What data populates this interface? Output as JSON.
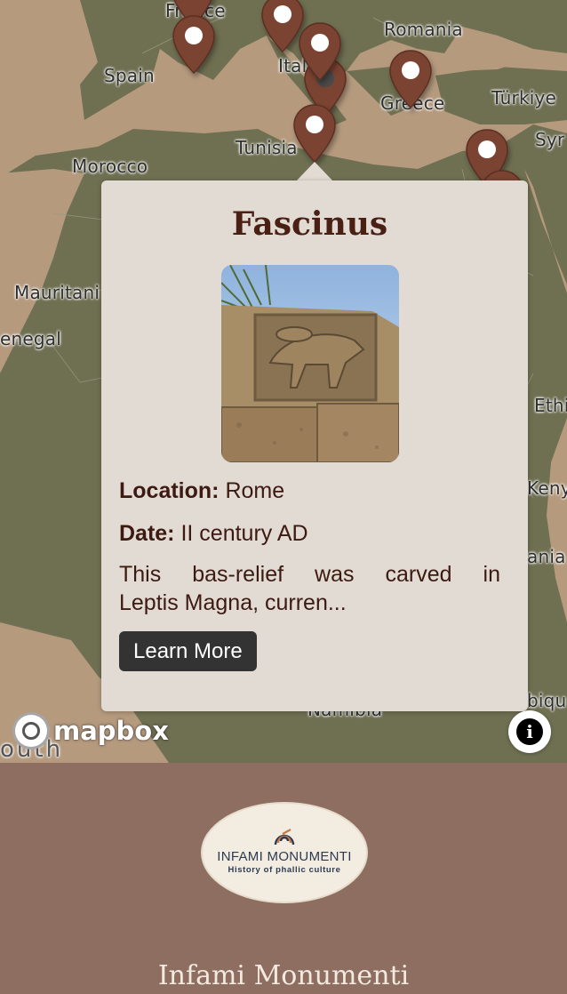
{
  "map": {
    "labels": [
      {
        "id": "france",
        "text": "France"
      },
      {
        "id": "spain",
        "text": "Spain"
      },
      {
        "id": "italy",
        "text": "Italy"
      },
      {
        "id": "romania",
        "text": "Romania"
      },
      {
        "id": "greece",
        "text": "Greece"
      },
      {
        "id": "turkiye",
        "text": "Türkiye"
      },
      {
        "id": "syria",
        "text": "Syr"
      },
      {
        "id": "tunisia",
        "text": "Tunisia"
      },
      {
        "id": "morocco",
        "text": "Morocco"
      },
      {
        "id": "mauritania",
        "text": "Mauritani"
      },
      {
        "id": "senegal",
        "text": "enegal"
      },
      {
        "id": "ethiopia",
        "text": "Ethi"
      },
      {
        "id": "kenya",
        "text": "Keny"
      },
      {
        "id": "tanzania",
        "text": "ania"
      },
      {
        "id": "mozambique",
        "text": "biqu"
      },
      {
        "id": "namibia",
        "text": "Namibia"
      },
      {
        "id": "south",
        "text": "outh"
      }
    ],
    "attribution_logo": "mapbox",
    "info_icon": "i",
    "colors": {
      "land": "#6f6f52",
      "water": "#b59a7e",
      "pin": "#7a4332"
    }
  },
  "popup": {
    "title": "Fascinus",
    "location_label": "Location:",
    "location_value": "Rome",
    "date_label": "Date:",
    "date_value": "II century AD",
    "description_line1": "This bas-relief was carved in",
    "description_line2": "Leptis Magna, curren...",
    "button_label": "Learn More"
  },
  "footer": {
    "logo_name": "INFAMI MONUMENTI",
    "logo_subtitle": "History of phallic culture",
    "site_title": "Infami Monumenti",
    "colors": {
      "background": "#8f6e62",
      "title": "#f3eadf"
    }
  }
}
